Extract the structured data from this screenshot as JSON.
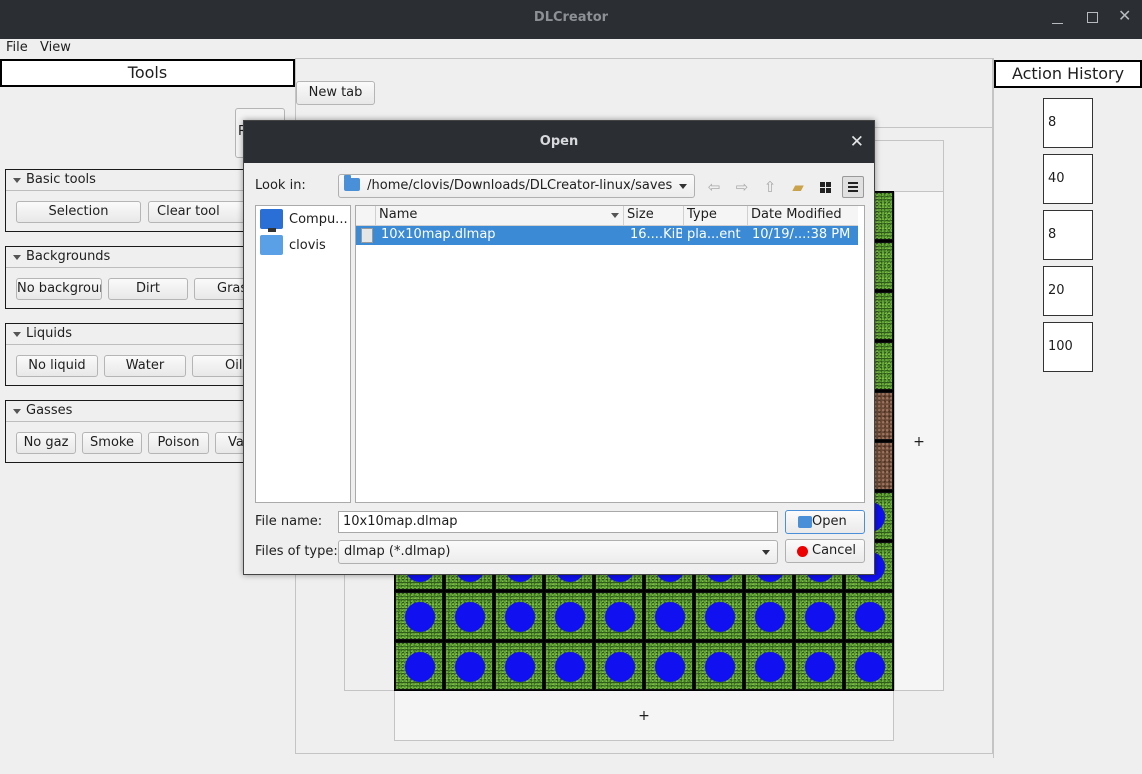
{
  "window": {
    "title": "DLCreator"
  },
  "menu": {
    "file": "File",
    "view": "View"
  },
  "tools": {
    "header": "Tools",
    "stub_label": "R",
    "groups": [
      {
        "title": "Basic tools",
        "buttons": [
          "Selection",
          "Clear tool"
        ]
      },
      {
        "title": "Backgrounds",
        "buttons": [
          "No background",
          "Dirt",
          "Grass"
        ]
      },
      {
        "title": "Liquids",
        "buttons": [
          "No liquid",
          "Water",
          "Oil"
        ]
      },
      {
        "title": "Gasses",
        "buttons": [
          "No gaz",
          "Smoke",
          "Poison",
          "Vap"
        ]
      }
    ]
  },
  "editor": {
    "new_tab": "New tab",
    "add_column": "+",
    "add_row": "+"
  },
  "history": {
    "header": "Action History",
    "items": [
      "8",
      "40",
      "8",
      "20",
      "100"
    ]
  },
  "dialog": {
    "title": "Open",
    "look_in_label": "Look in:",
    "look_in_path": "/home/clovis/Downloads/DLCreator-linux/saves",
    "places": [
      "Compu...",
      "clovis"
    ],
    "columns": [
      "Name",
      "Size",
      "Type",
      "Date Modified"
    ],
    "files": [
      {
        "name": "10x10map.dlmap",
        "size": "16....KiB",
        "type": "pla...ent",
        "date": "10/19/...:38 PM",
        "selected": true
      }
    ],
    "file_name_label": "File name:",
    "file_name_value": "10x10map.dlmap",
    "file_type_label": "Files of type:",
    "file_type_value": "dlmap (*.dlmap)",
    "open_button": "Open",
    "cancel_button": "Cancel"
  }
}
